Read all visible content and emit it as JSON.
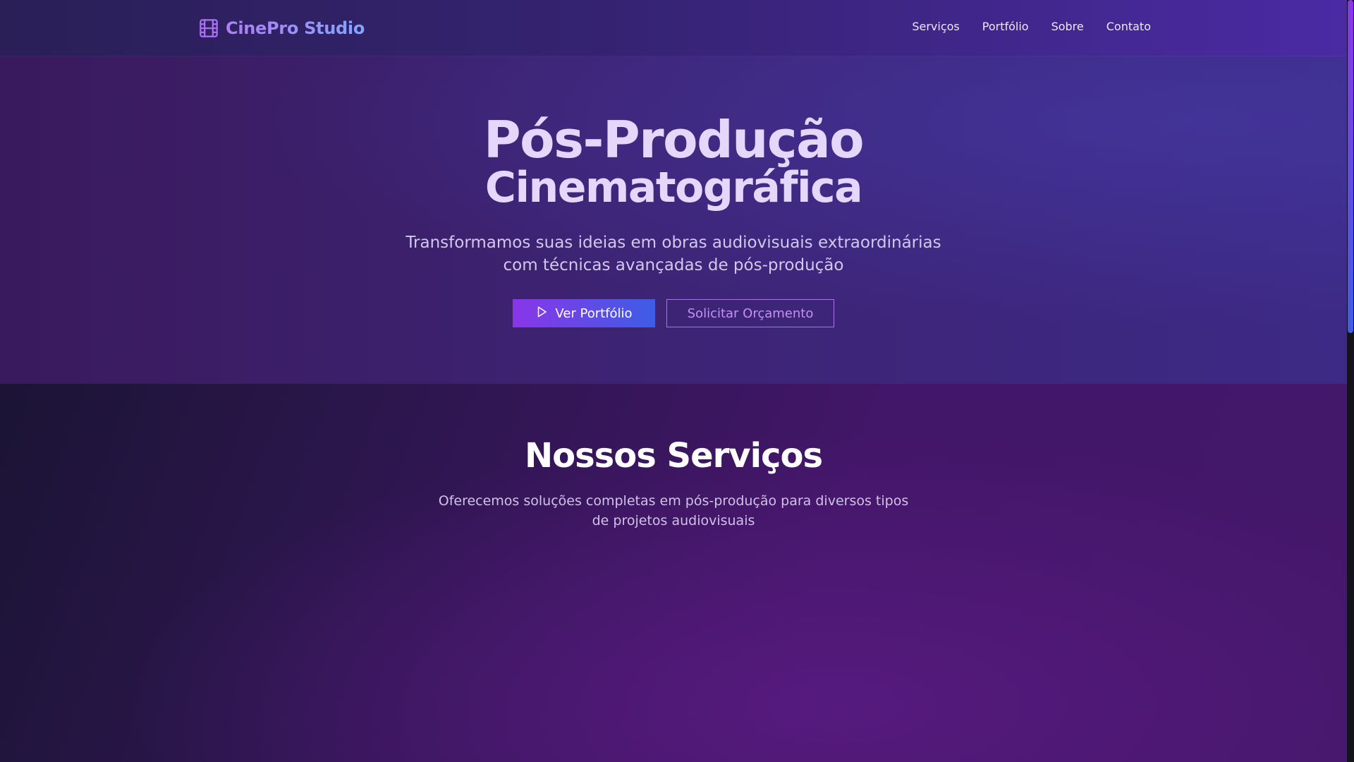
{
  "header": {
    "brand": "CinePro Studio",
    "logo_icon": "film-icon",
    "nav": {
      "services": "Serviços",
      "portfolio": "Portfólio",
      "about": "Sobre",
      "contact": "Contato"
    }
  },
  "hero": {
    "title_line1": "Pós-Produção",
    "title_line2": "Cinematográfica",
    "subtitle_line1": "Transformamos suas ideias em obras audiovisuais extraordinárias",
    "subtitle_line2": "com técnicas avançadas de pós-produção",
    "primary_button": {
      "label": "Ver Portfólio",
      "icon": "play-icon"
    },
    "secondary_button": {
      "label": "Solicitar Orçamento"
    }
  },
  "services": {
    "title": "Nossos Serviços",
    "subtitle_line1": "Oferecemos soluções completas em pós-produção para diversos tipos",
    "subtitle_line2": "de projetos audiovisuais"
  },
  "colors": {
    "accent_purple": "#8a36e8",
    "accent_blue": "#3e5de6",
    "outline_purple": "#a675e8"
  }
}
